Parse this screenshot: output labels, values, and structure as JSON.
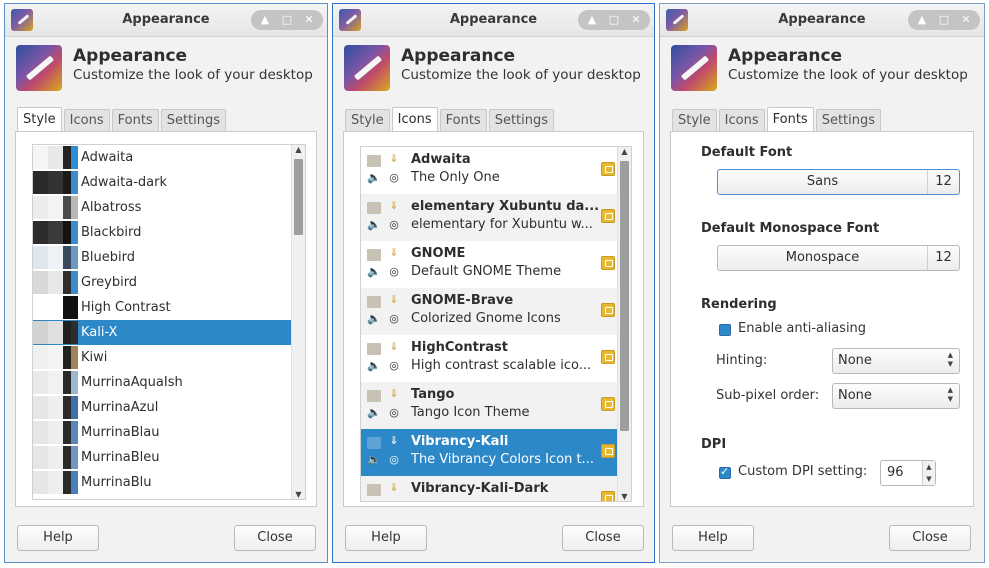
{
  "app": {
    "window_title": "Appearance",
    "title": "Appearance",
    "subtitle": "Customize the look of your desktop"
  },
  "tabs": [
    "Style",
    "Icons",
    "Fonts",
    "Settings"
  ],
  "buttons": {
    "help": "Help",
    "close": "Close"
  },
  "style_list": {
    "items": [
      {
        "label": "Adwaita",
        "colors": [
          "#f5f5f5",
          "#e8e8e8",
          "#232323",
          "#2e8dd0"
        ]
      },
      {
        "label": "Adwaita-dark",
        "colors": [
          "#2a2a2a",
          "#333333",
          "#1a1a1a",
          "#3a8bd0"
        ]
      },
      {
        "label": "Albatross",
        "colors": [
          "#ececec",
          "#f3f3f3",
          "#4a4a4a",
          "#b7b7b7"
        ]
      },
      {
        "label": "Blackbird",
        "colors": [
          "#2c2c2c",
          "#3a3a3a",
          "#141414",
          "#3a8bd0"
        ]
      },
      {
        "label": "Bluebird",
        "colors": [
          "#dfe6ee",
          "#eef2f6",
          "#3a4a5c",
          "#6c98c4"
        ]
      },
      {
        "label": "Greybird",
        "colors": [
          "#d8d8d8",
          "#e8e8e8",
          "#2e2e2e",
          "#3a8bd0"
        ]
      },
      {
        "label": "High Contrast",
        "colors": [
          "#ffffff",
          "#ffffff",
          "#111111",
          "#111111"
        ]
      },
      {
        "label": "Kali-X",
        "colors": [
          "#d2d2d2",
          "#e0e0e0",
          "#202020",
          "#2d2d2d"
        ]
      },
      {
        "label": "Kiwi",
        "colors": [
          "#efefef",
          "#f4f4f4",
          "#222222",
          "#a0845a"
        ]
      },
      {
        "label": "MurrinaAquaIsh",
        "colors": [
          "#e9e9e9",
          "#f1f1f1",
          "#2a2a2a",
          "#9bb8cc"
        ]
      },
      {
        "label": "MurrinaAzul",
        "colors": [
          "#e6e6e6",
          "#eeeeee",
          "#2a2a2a",
          "#3d6fa8"
        ]
      },
      {
        "label": "MurrinaBlau",
        "colors": [
          "#e6e6e6",
          "#eeeeee",
          "#2a2a2a",
          "#5a86b8"
        ]
      },
      {
        "label": "MurrinaBleu",
        "colors": [
          "#e6e6e6",
          "#eeeeee",
          "#2a2a2a",
          "#7196c4"
        ]
      },
      {
        "label": "MurrinaBlu",
        "colors": [
          "#e6e6e6",
          "#eeeeee",
          "#2a2a2a",
          "#4a7fbf"
        ]
      }
    ],
    "selected": "Kali-X"
  },
  "icon_list": {
    "items": [
      {
        "name": "Adwaita",
        "desc": "The Only One"
      },
      {
        "name": "elementary Xubuntu da...",
        "desc": "elementary for Xubuntu w..."
      },
      {
        "name": "GNOME",
        "desc": "Default GNOME Theme"
      },
      {
        "name": "GNOME-Brave",
        "desc": "Colorized Gnome Icons"
      },
      {
        "name": "HighContrast",
        "desc": "High contrast scalable ico..."
      },
      {
        "name": "Tango",
        "desc": "Tango Icon Theme"
      },
      {
        "name": "Vibrancy-Kali",
        "desc": "The Vibrancy Colors Icon t..."
      },
      {
        "name": "Vibrancy-Kali-Dark",
        "desc": ""
      }
    ],
    "selected": "Vibrancy-Kali"
  },
  "fonts": {
    "default_heading": "Default Font",
    "default_font": "Sans",
    "default_size": "12",
    "mono_heading": "Default Monospace Font",
    "mono_font": "Monospace",
    "mono_size": "12",
    "rendering_heading": "Rendering",
    "antialias_label": "Enable anti-aliasing",
    "hinting_label": "Hinting:",
    "hinting_value": "None",
    "subpixel_label": "Sub-pixel order:",
    "subpixel_value": "None",
    "dpi_heading": "DPI",
    "dpi_label": "Custom DPI setting:",
    "dpi_value": "96"
  },
  "colors": {
    "accent": "#2d88c8",
    "window_border": "#2e6fc0"
  }
}
